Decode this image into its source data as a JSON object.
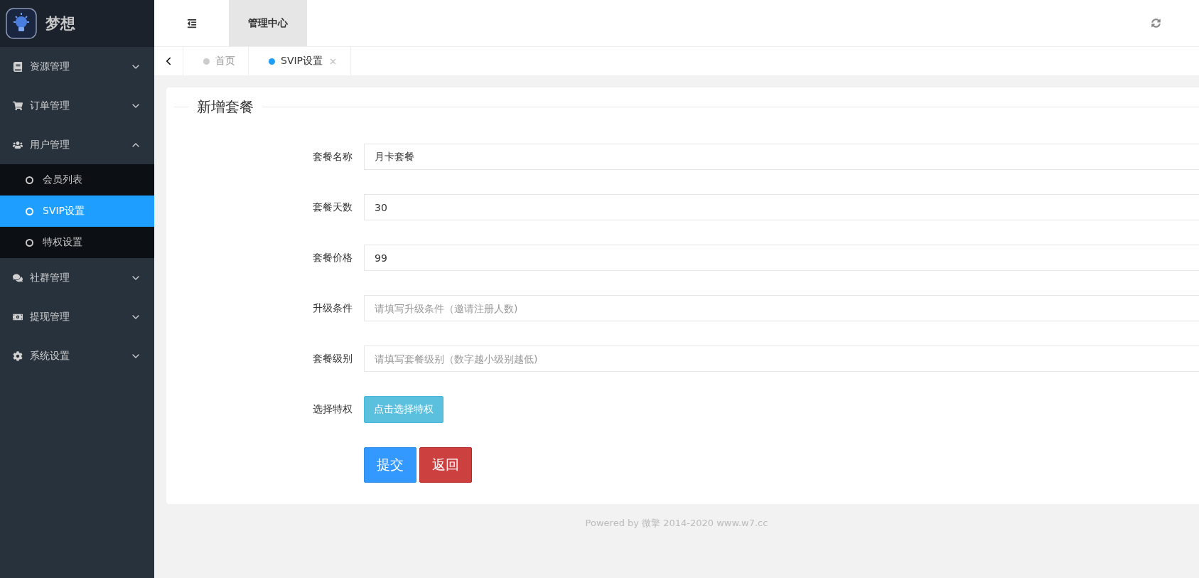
{
  "sidebar": {
    "brand": "梦想",
    "menu": [
      {
        "label": "资源管理",
        "expanded": false
      },
      {
        "label": "订单管理",
        "expanded": false
      },
      {
        "label": "用户管理",
        "expanded": true,
        "children": [
          {
            "label": "会员列表",
            "selected": false
          },
          {
            "label": "SVIP设置",
            "selected": true
          },
          {
            "label": "特权设置",
            "selected": false
          }
        ]
      },
      {
        "label": "社群管理",
        "expanded": false
      },
      {
        "label": "提现管理",
        "expanded": false
      },
      {
        "label": "系统设置",
        "expanded": false
      }
    ]
  },
  "header": {
    "title": "管理中心"
  },
  "tabs": [
    {
      "label": "首页",
      "selected": false,
      "closable": false
    },
    {
      "label": "SVIP设置",
      "selected": true,
      "closable": true
    }
  ],
  "form": {
    "legend": "新增套餐",
    "fields": [
      {
        "kind": "input",
        "label": "套餐名称",
        "value": "月卡套餐"
      },
      {
        "kind": "input",
        "label": "套餐天数",
        "value": "30"
      },
      {
        "kind": "input",
        "label": "套餐价格",
        "value": "99"
      },
      {
        "kind": "input",
        "label": "升级条件",
        "placeholder": "请填写升级条件（邀请注册人数)"
      },
      {
        "kind": "input",
        "label": "套餐级别",
        "placeholder": "请填写套餐级别（数字越小级别越低)"
      },
      {
        "kind": "button",
        "label": "选择特权",
        "button": "点击选择特权"
      }
    ],
    "actions": [
      {
        "label": "提交",
        "kind": "primary"
      },
      {
        "label": "返回",
        "kind": "danger"
      }
    ]
  },
  "footer": "Powered by 微擎 2014-2020 www.w7.cc"
}
